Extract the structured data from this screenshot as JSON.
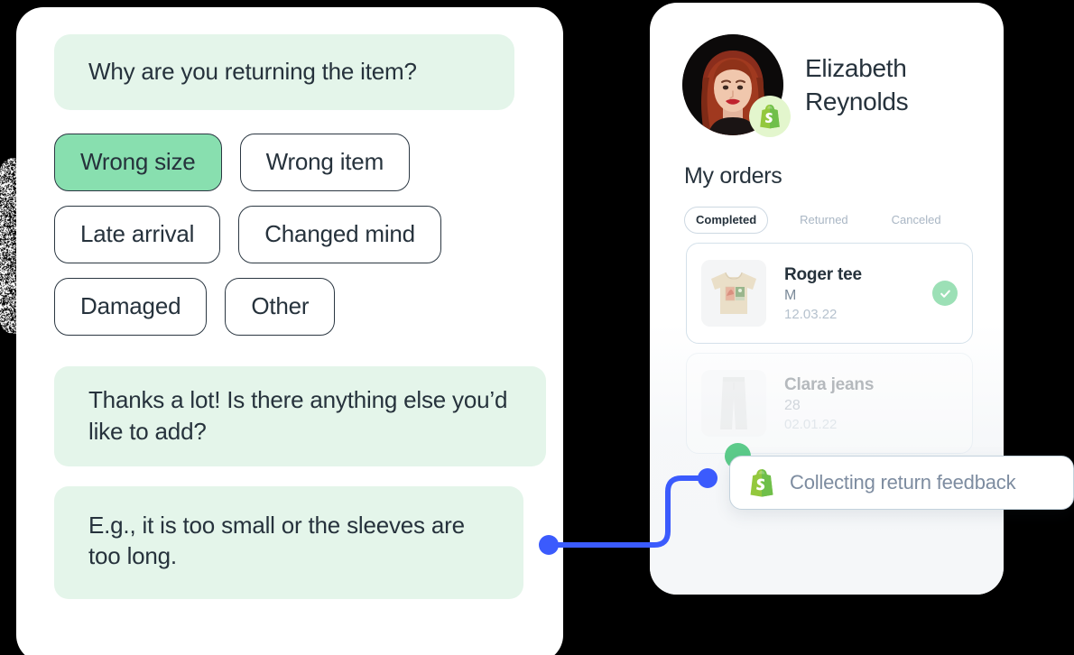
{
  "colors": {
    "background": "#000000",
    "panel": "#ffffff",
    "bubble_green": "#e4f5ea",
    "chip_selected": "#88dfaf",
    "chip_border": "#2b3742",
    "text_dark": "#26323c",
    "text_muted": "#7d8ca0",
    "connector_blue": "#3b5bfd",
    "dot_green": "#5ccb8a",
    "check_badge_green": "#9ce0b6",
    "shopify_green": "#6fbf4a",
    "panel_wash": "#f5f7f9"
  },
  "chat": {
    "question": "Why are you returning the item?",
    "options": [
      {
        "label": "Wrong size",
        "selected": true
      },
      {
        "label": "Wrong item",
        "selected": false
      },
      {
        "label": "Late arrival",
        "selected": false
      },
      {
        "label": "Changed mind",
        "selected": false
      },
      {
        "label": "Damaged",
        "selected": false
      },
      {
        "label": "Other",
        "selected": false
      }
    ],
    "followup": "Thanks a lot! Is there anything else you’d like to add?",
    "example": "E.g., it is too small or the sleeves are too long."
  },
  "profile": {
    "name": "Elizabeth\nReynolds",
    "avatar_icon": "user-photo",
    "badge_icon": "shopify-bag-icon"
  },
  "orders": {
    "title": "My orders",
    "tabs": [
      {
        "label": "Completed",
        "active": true
      },
      {
        "label": "Returned",
        "active": false
      },
      {
        "label": "Canceled",
        "active": false
      }
    ],
    "items": [
      {
        "name": "Roger tee",
        "size": "M",
        "date": "12.03.22",
        "thumb_icon": "tshirt-thumbnail",
        "status_icon": "check-circle-icon",
        "faded": false
      },
      {
        "name": "Clara jeans",
        "size": "28",
        "date": "02.01.22",
        "thumb_icon": "jeans-thumbnail",
        "status_icon": "",
        "faded": true
      }
    ]
  },
  "callout": {
    "icon": "shopify-bag-icon",
    "text": "Collecting return feedback"
  }
}
